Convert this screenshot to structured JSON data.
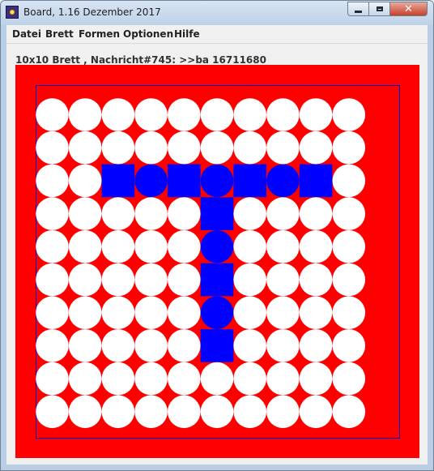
{
  "window": {
    "title": "Board, 1.16 Dezember 2017",
    "buttons": {
      "minimize": "minimize-icon",
      "maximize": "maximize-icon",
      "close": "close-icon",
      "close_glyph": "✕"
    }
  },
  "menu": [
    "Datei",
    "Brett",
    "Formen",
    "Optionen",
    "Hilfe"
  ],
  "status": {
    "text": "10x10 Brett , Nachricht#745: >>ba 16711680"
  },
  "board": {
    "rows": 10,
    "cols": 10,
    "background_color": "#ff0000",
    "frame_color": "#0000cc",
    "empty_color": "#ffffff",
    "piece_color": "#0000ff",
    "pieces": [
      {
        "row": 3,
        "col": 3,
        "shape": "square"
      },
      {
        "row": 3,
        "col": 4,
        "shape": "circle"
      },
      {
        "row": 3,
        "col": 5,
        "shape": "square"
      },
      {
        "row": 3,
        "col": 6,
        "shape": "circle"
      },
      {
        "row": 3,
        "col": 7,
        "shape": "square"
      },
      {
        "row": 3,
        "col": 8,
        "shape": "circle"
      },
      {
        "row": 3,
        "col": 9,
        "shape": "square"
      },
      {
        "row": 4,
        "col": 6,
        "shape": "square"
      },
      {
        "row": 5,
        "col": 6,
        "shape": "circle"
      },
      {
        "row": 6,
        "col": 6,
        "shape": "square"
      },
      {
        "row": 7,
        "col": 6,
        "shape": "circle"
      },
      {
        "row": 8,
        "col": 6,
        "shape": "square"
      }
    ]
  }
}
